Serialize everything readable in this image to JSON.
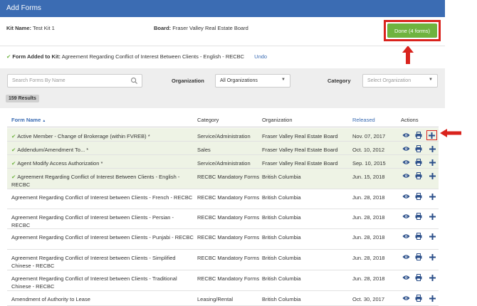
{
  "header": {
    "title": "Add Forms"
  },
  "kit": {
    "name_label": "Kit Name:",
    "name_value": "Test Kit 1",
    "board_label": "Board:",
    "board_value": "Fraser Valley Real Estate Board"
  },
  "done_button": {
    "label": "Done (4 forms)"
  },
  "notice": {
    "label": "Form Added to Kit:",
    "value": "Agreement Regarding Conflict of Interest Between Clients - English - RECBC",
    "undo": "Undo"
  },
  "filters": {
    "search_placeholder": "Search Forms By Name",
    "organization_label": "Organization",
    "organization_value": "All Organizations",
    "category_label": "Category",
    "category_placeholder": "Select Organization",
    "results": "159 Results"
  },
  "table": {
    "headers": {
      "name": "Form Name",
      "category": "Category",
      "organization": "Organization",
      "released": "Released",
      "actions": "Actions"
    },
    "rows": [
      {
        "name": "Active Member - Change of Brokerage (within FVREB) *",
        "category": "Service/Administration",
        "organization": "Fraser Valley Real Estate Board",
        "released": "Nov. 07, 2017",
        "added": true
      },
      {
        "name": "Addendum/Amendment To... *",
        "category": "Sales",
        "organization": "Fraser Valley Real Estate Board",
        "released": "Oct. 10, 2012",
        "added": true
      },
      {
        "name": "Agent Modify Access Authorization *",
        "category": "Service/Administration",
        "organization": "Fraser Valley Real Estate Board",
        "released": "Sep. 10, 2015",
        "added": true
      },
      {
        "name": "Agreement Regarding Conflict of Interest Between Clients - English - RECBC",
        "category": "RECBC Mandatory Forms",
        "organization": "British Columbia",
        "released": "Jun. 15, 2018",
        "added": true
      },
      {
        "name": "Agreement Regarding Conflict of Interest between Clients - French - RECBC",
        "category": "RECBC Mandatory Forms",
        "organization": "British Columbia",
        "released": "Jun. 28, 2018",
        "added": false
      },
      {
        "name": "Agreement Regarding Conflict of Interest between Clients - Persian - RECBC",
        "category": "RECBC Mandatory Forms",
        "organization": "British Columbia",
        "released": "Jun. 28, 2018",
        "added": false
      },
      {
        "name": "Agreement Regarding Conflict of Interest between Clients - Punjabi - RECBC",
        "category": "RECBC Mandatory Forms",
        "organization": "British Columbia",
        "released": "Jun. 28, 2018",
        "added": false
      },
      {
        "name": "Agreement Regarding Conflict of Interest between Clients - Simplified Chinese - RECBC",
        "category": "RECBC Mandatory Forms",
        "organization": "British Columbia",
        "released": "Jun. 28, 2018",
        "added": false
      },
      {
        "name": "Agreement Regarding Conflict of Interest between Clients - Traditional Chinese - RECBC",
        "category": "RECBC Mandatory Forms",
        "organization": "British Columbia",
        "released": "Jun. 28, 2018",
        "added": false
      },
      {
        "name": "Amendment of Authority to Lease",
        "category": "Leasing/Rental",
        "organization": "British Columbia",
        "released": "Oct. 30, 2017",
        "added": false
      }
    ]
  },
  "icons": {
    "view": "eye-icon",
    "print": "print-icon",
    "add": "plus-icon",
    "search": "search-icon",
    "sort": "sort-up-icon",
    "check": "check-icon"
  },
  "colors": {
    "header_blue": "#3b6cb3",
    "done_green": "#6fb33f",
    "highlight_red": "#d9231d",
    "added_row_bg": "#eef3e5"
  }
}
